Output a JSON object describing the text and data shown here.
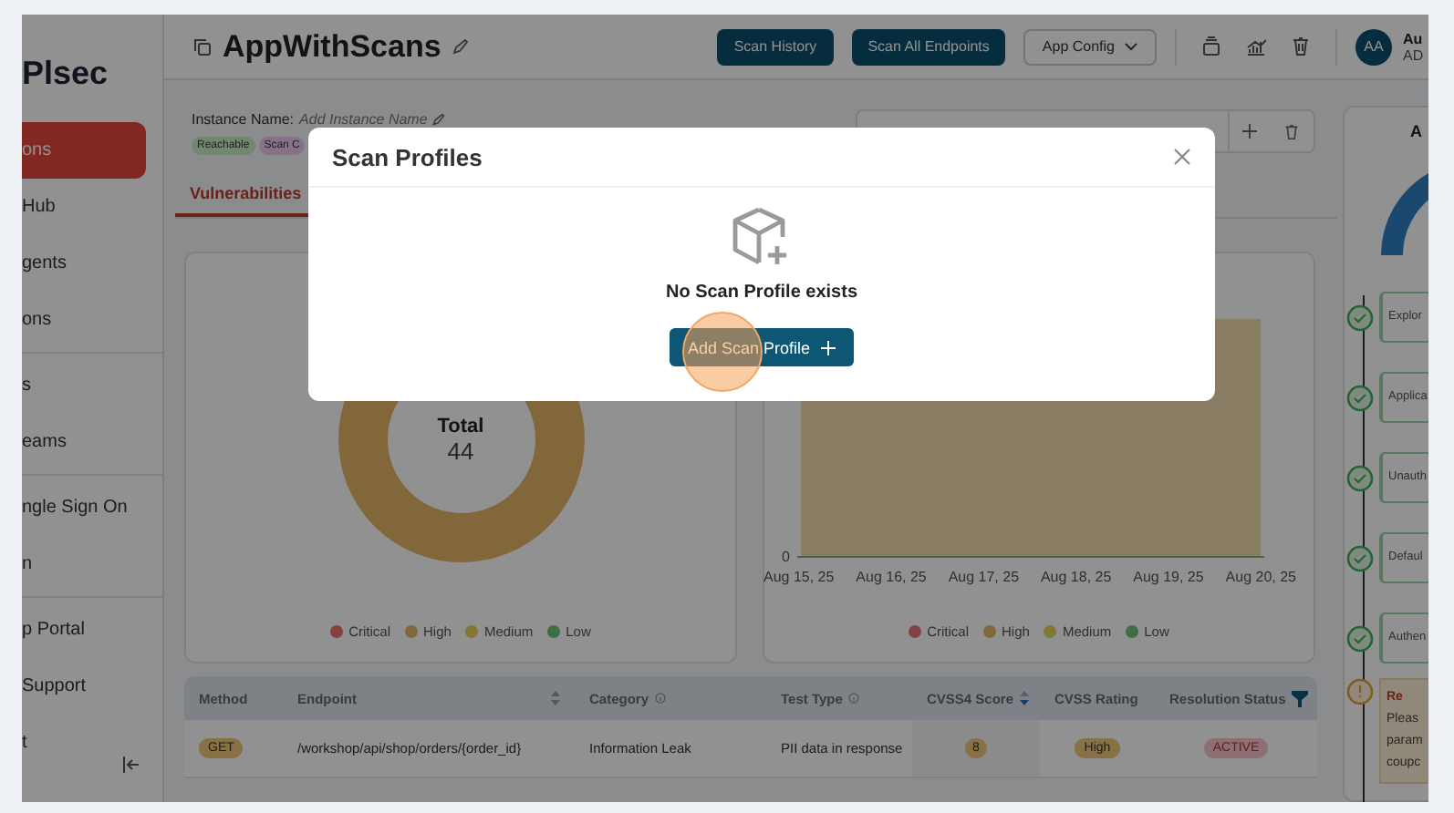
{
  "sidebar": {
    "brand": "Plsec",
    "groups": [
      [
        {
          "label": "ons",
          "selected": true
        },
        {
          "label": "Hub",
          "selected": false
        },
        {
          "label": "gents",
          "selected": false
        },
        {
          "label": "ons",
          "selected": false
        }
      ],
      [
        {
          "label": "s",
          "selected": false
        },
        {
          "label": "eams",
          "selected": false
        }
      ],
      [
        {
          "label": "ngle Sign On",
          "selected": false
        },
        {
          "label": "n",
          "selected": false
        }
      ],
      [
        {
          "label": "p Portal",
          "selected": false
        },
        {
          "label": "Support",
          "selected": false
        },
        {
          "label": "t",
          "selected": false
        }
      ]
    ]
  },
  "header": {
    "title": "AppWithScans",
    "buttons": [
      {
        "label": "Scan History",
        "kind": "primary"
      },
      {
        "label": "Scan All Endpoints",
        "kind": "primary"
      },
      {
        "label": "App Config",
        "kind": "dropdown"
      }
    ],
    "avatar": "AA",
    "user_lines": [
      "Au",
      "AD"
    ]
  },
  "instance": {
    "label": "Instance Name:",
    "placeholder": "Add Instance Name",
    "badges": [
      {
        "label": "Reachable",
        "color": "#728770"
      },
      {
        "label": "Scan C",
        "color": "#877188"
      }
    ]
  },
  "tabs": [
    {
      "label": "Vulnerabilities",
      "selected": true
    }
  ],
  "donut_card": {
    "total_label": "Total",
    "total": "44",
    "legend": [
      {
        "label": "Critical",
        "color": "#834141"
      },
      {
        "label": "High",
        "color": "#81673b"
      },
      {
        "label": "Medium",
        "color": "#837833"
      },
      {
        "label": "Low",
        "color": "#3e6e46"
      }
    ]
  },
  "trend_card": {
    "y_tick": "0",
    "x_labels": [
      "Aug 15, 25",
      "Aug 16, 25",
      "Aug 17, 25",
      "Aug 18, 25",
      "Aug 19, 25",
      "Aug 20, 25"
    ],
    "legend": [
      {
        "label": "Critical",
        "color": "#834141"
      },
      {
        "label": "High",
        "color": "#81673b"
      },
      {
        "label": "Medium",
        "color": "#837833"
      },
      {
        "label": "Low",
        "color": "#3e6e46"
      }
    ]
  },
  "table": {
    "columns": [
      {
        "label": "Method"
      },
      {
        "label": "Endpoint"
      },
      {
        "label": "Category"
      },
      {
        "label": "Test Type"
      },
      {
        "label": "CVSS4 Score"
      },
      {
        "label": "CVSS Rating"
      },
      {
        "label": "Resolution Status"
      }
    ],
    "rows": [
      {
        "method": "GET",
        "endpoint": "/workshop/api/shop/orders/{order_id}",
        "category": "Information Leak",
        "test_type": "PII data in response",
        "score": "8",
        "rating": "High",
        "status": "ACTIVE"
      }
    ]
  },
  "right_panel": {
    "title": "A",
    "steps": [
      {
        "label": "Explor"
      },
      {
        "label": "Applica"
      },
      {
        "label": "Unauth"
      },
      {
        "label": "Defaul"
      },
      {
        "label": "Authen"
      }
    ],
    "alert": {
      "title": "Re",
      "lines": [
        "Pleas",
        "param",
        "coupc"
      ]
    }
  },
  "modal": {
    "title": "Scan Profiles",
    "message": "No Scan Profile exists",
    "button": "Add Scan Profile"
  }
}
